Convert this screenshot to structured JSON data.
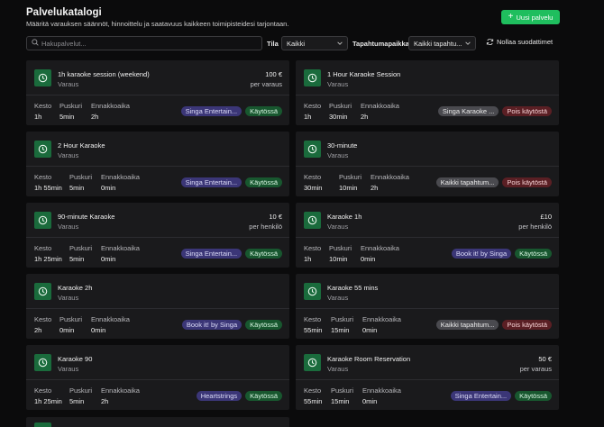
{
  "header": {
    "title": "Palvelukatalogi",
    "subtitle": "Määritä varauksen säännöt, hinnoittelu ja saatavuus kaikkeen toimipisteidesi tarjontaan.",
    "new_button": "Uusi palvelu"
  },
  "filters": {
    "search_placeholder": "Hakupalvelut...",
    "status_label": "Tila",
    "status_value": "Kaikki",
    "venue_label": "Tapahtumapaikka",
    "venue_value": "Kaikki tapahtu...",
    "reset_label": "Nollaa suodattimet"
  },
  "labels": {
    "duration": "Kesto",
    "buffer": "Puskuri",
    "advance": "Ennakkoaika"
  },
  "services": [
    {
      "name": "1h karaoke session (weekend)",
      "type": "Varaus",
      "price": "100 €",
      "price_unit": "per varaus",
      "duration": "1h",
      "buffer": "5min",
      "advance": "2h",
      "venue": "Singa Entertain...",
      "venue_style": "purple",
      "status": "Käytössä",
      "active": true
    },
    {
      "name": "1 Hour Karaoke Session",
      "type": "Varaus",
      "price": "",
      "price_unit": "",
      "duration": "1h",
      "buffer": "30min",
      "advance": "2h",
      "venue": "Singa Karaoke ...",
      "venue_style": "gray",
      "status": "Pois käytöstä",
      "active": false
    },
    {
      "name": "2 Hour Karaoke",
      "type": "Varaus",
      "price": "",
      "price_unit": "",
      "duration": "1h 55min",
      "buffer": "5min",
      "advance": "0min",
      "venue": "Singa Entertain...",
      "venue_style": "purple",
      "status": "Käytössä",
      "active": true
    },
    {
      "name": "30-minute",
      "type": "Varaus",
      "price": "",
      "price_unit": "",
      "duration": "30min",
      "buffer": "10min",
      "advance": "2h",
      "venue": "Kaikki tapahtum...",
      "venue_style": "gray",
      "status": "Pois käytöstä",
      "active": false
    },
    {
      "name": "90-minute Karaoke",
      "type": "Varaus",
      "price": "10 €",
      "price_unit": "per henkilö",
      "duration": "1h 25min",
      "buffer": "5min",
      "advance": "0min",
      "venue": "Singa Entertain...",
      "venue_style": "purple",
      "status": "Käytössä",
      "active": true
    },
    {
      "name": "Karaoke 1h",
      "type": "Varaus",
      "price": "£10",
      "price_unit": "per henkilö",
      "duration": "1h",
      "buffer": "10min",
      "advance": "0min",
      "venue": "Book it! by Singa",
      "venue_style": "purple",
      "status": "Käytössä",
      "active": true
    },
    {
      "name": "Karaoke 2h",
      "type": "Varaus",
      "price": "",
      "price_unit": "",
      "duration": "2h",
      "buffer": "0min",
      "advance": "0min",
      "venue": "Book it! by Singa",
      "venue_style": "purple",
      "status": "Käytössä",
      "active": true
    },
    {
      "name": "Karaoke 55 mins",
      "type": "Varaus",
      "price": "",
      "price_unit": "",
      "duration": "55min",
      "buffer": "15min",
      "advance": "0min",
      "venue": "Kaikki tapahtum...",
      "venue_style": "gray",
      "status": "Pois käytöstä",
      "active": false
    },
    {
      "name": "Karaoke 90",
      "type": "Varaus",
      "price": "",
      "price_unit": "",
      "duration": "1h 25min",
      "buffer": "5min",
      "advance": "2h",
      "venue": "Heartstrings",
      "venue_style": "purple",
      "status": "Käytössä",
      "active": true
    },
    {
      "name": "Karaoke Room Reservation",
      "type": "Varaus",
      "price": "50 €",
      "price_unit": "per varaus",
      "duration": "55min",
      "buffer": "15min",
      "advance": "0min",
      "venue": "Singa Entertain...",
      "venue_style": "purple",
      "status": "Käytössä",
      "active": true
    }
  ],
  "icons": {
    "card": "clock-icon",
    "search": "search-icon",
    "new": "plus-icon",
    "reset": "refresh-icon",
    "select": "chevron-down-icon"
  },
  "colors": {
    "accent": "#1fbe5e",
    "icon_bg": "#1a6b3c",
    "active_badge": "#18572f",
    "inactive_badge": "#5a1f24",
    "venue_badge": "#3b3677"
  }
}
